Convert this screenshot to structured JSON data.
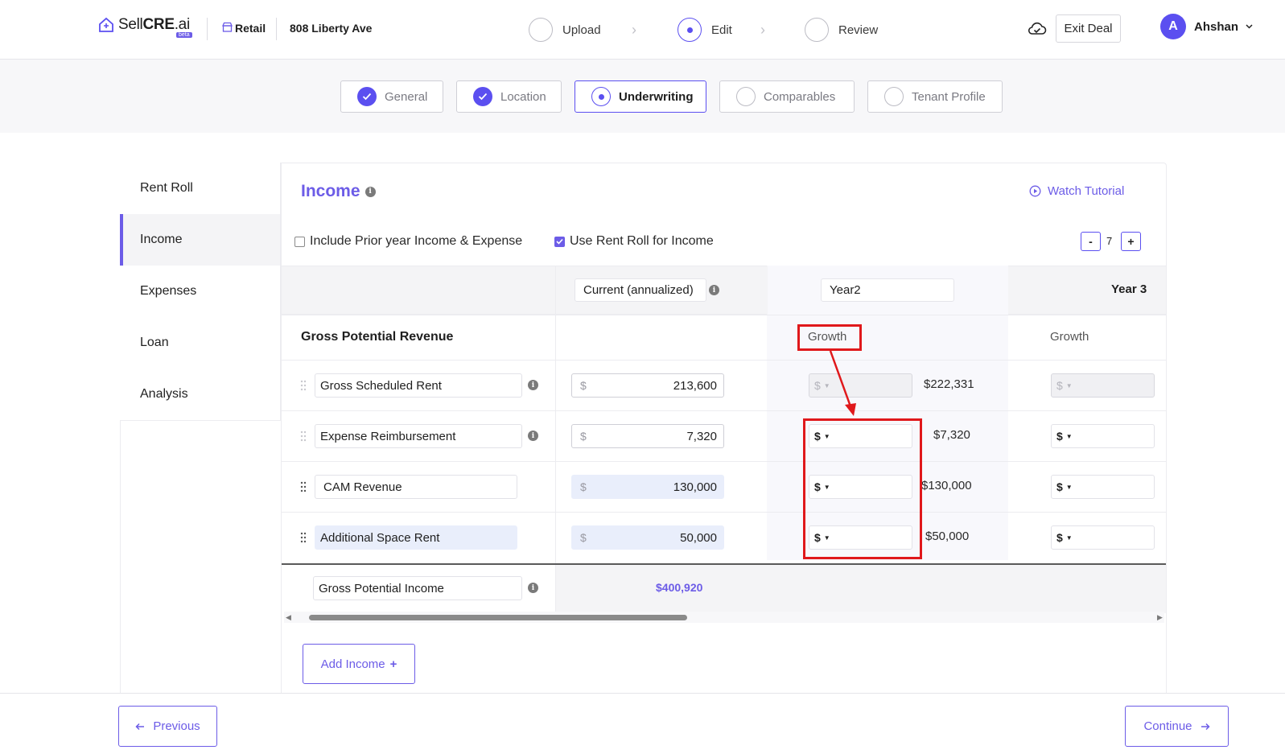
{
  "header": {
    "brand_regular": "Sell",
    "brand_bold": "CRE",
    "brand_suffix": ".ai",
    "beta": "beta",
    "property_type": "Retail",
    "address": "808 Liberty Ave",
    "steps": [
      {
        "label": "Upload",
        "state": "pending"
      },
      {
        "label": "Edit",
        "state": "active"
      },
      {
        "label": "Review",
        "state": "pending"
      }
    ],
    "exit_label": "Exit Deal",
    "avatar_initial": "A",
    "user_name": "Ahshan"
  },
  "subtabs": [
    {
      "label": "General",
      "state": "done"
    },
    {
      "label": "Location",
      "state": "done"
    },
    {
      "label": "Underwriting",
      "state": "active"
    },
    {
      "label": "Comparables",
      "state": "pending"
    },
    {
      "label": "Tenant Profile",
      "state": "pending"
    }
  ],
  "sidenav": {
    "items": [
      "Rent Roll",
      "Income",
      "Expenses",
      "Loan",
      "Analysis"
    ],
    "active": "Income"
  },
  "income": {
    "title": "Income",
    "watch_tutorial": "Watch Tutorial",
    "include_prior_label": "Include Prior year Income & Expense",
    "include_prior_checked": false,
    "use_rent_roll_label": "Use Rent Roll for Income",
    "use_rent_roll_checked": true,
    "years_minus": "-",
    "years_value": "7",
    "years_plus": "+"
  },
  "table": {
    "col_current": "Current (annualized)",
    "col_year2": "Year2",
    "col_year3": "Year 3",
    "section_label": "Gross Potential Revenue",
    "growth_label": "Growth",
    "rows": [
      {
        "name": "Gross Scheduled Rent",
        "currency": "$",
        "current": "213,600",
        "y2_unit": "$",
        "y2_value": "$222,331",
        "y3_unit": "$",
        "locked": true,
        "highlight": false
      },
      {
        "name": "Expense Reimbursement",
        "currency": "$",
        "current": "7,320",
        "y2_unit": "$",
        "y2_value": "$7,320",
        "y3_unit": "$",
        "locked": false,
        "highlight": false
      },
      {
        "name": "CAM Revenue",
        "currency": "$",
        "current": "130,000",
        "y2_unit": "$",
        "y2_value": "$130,000",
        "y3_unit": "$",
        "locked": false,
        "highlight": true
      },
      {
        "name": "Additional Space Rent",
        "currency": "$",
        "current": "50,000",
        "y2_unit": "$",
        "y2_value": "$50,000",
        "y3_unit": "$",
        "locked": false,
        "highlight": true
      }
    ],
    "total_label": "Gross Potential Income",
    "total_value": "$400,920"
  },
  "add_income_label": "Add Income",
  "footer": {
    "previous_label": "Previous",
    "continue_label": "Continue"
  },
  "colors": {
    "accent": "#6c5ce7",
    "annotation": "#e0181b"
  }
}
